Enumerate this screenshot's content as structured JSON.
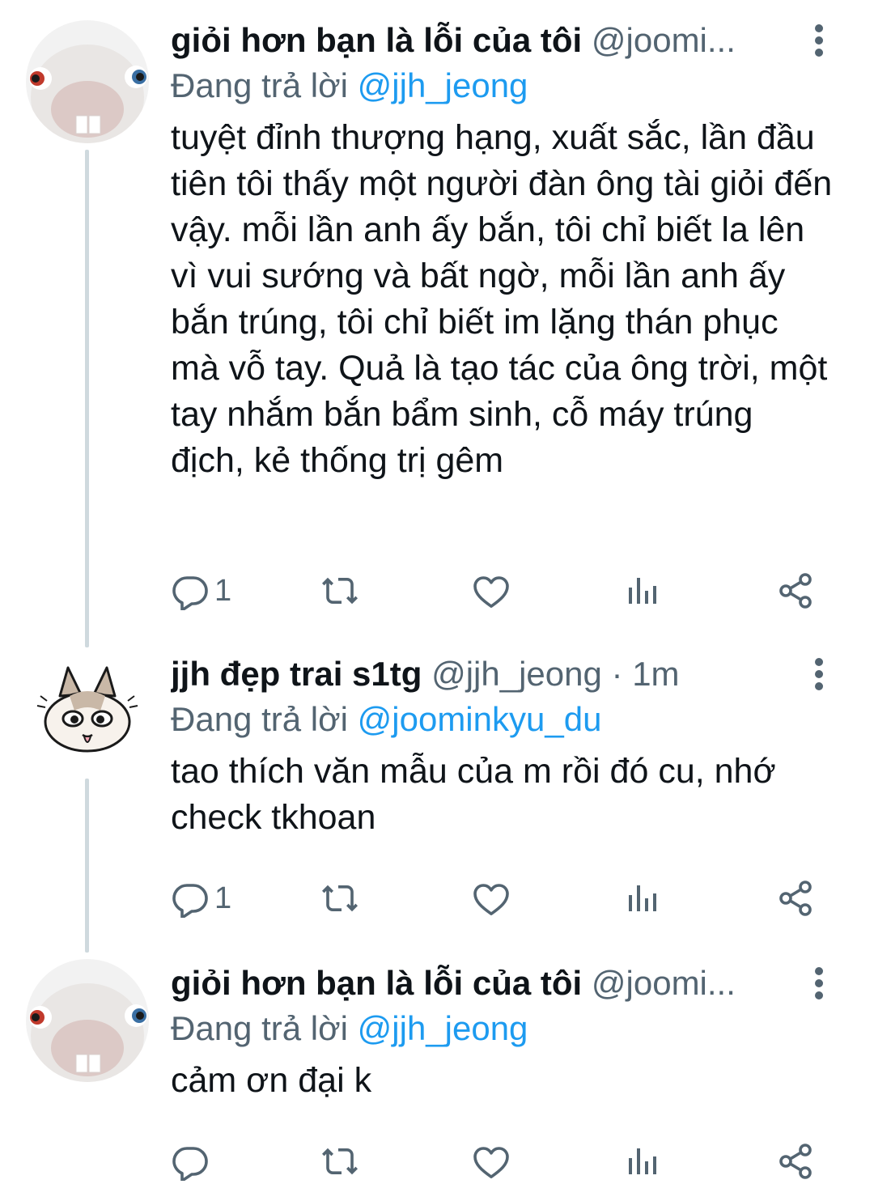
{
  "tweets": [
    {
      "display_name": "giỏi hơn bạn là lỗi của tôi",
      "handle": "@joomi...",
      "separator": "",
      "time": "",
      "reply_prefix": "Đang trả lời",
      "reply_mention": "@jjh_jeong",
      "text": "tuyệt đỉnh thượng hạng, xuất sắc, lần đầu tiên tôi thấy một người đàn ông tài giỏi đến vậy. mỗi lần anh ấy bắn, tôi chỉ biết la lên vì vui sướng và bất ngờ, mỗi lần anh ấy bắn trúng, tôi chỉ biết im lặng thán phục mà vỗ tay. Quả là tạo tác của ông trời, một tay nhắm bắn bẩm sinh, cỗ máy trúng địch, kẻ thống trị gêm",
      "reply_count": "1",
      "avatar": "rabbid-avatar"
    },
    {
      "display_name": "jjh đẹp trai s1tg",
      "handle": "@jjh_jeong",
      "separator": "·",
      "time": "1m",
      "reply_prefix": "Đang trả lời",
      "reply_mention": "@joominkyu_du",
      "text": "tao thích văn mẫu của m rồi đó cu, nhớ check tkhoan",
      "reply_count": "1",
      "avatar": "cat-avatar"
    },
    {
      "display_name": "giỏi hơn bạn là lỗi của tôi",
      "handle": "@joomi...",
      "separator": "",
      "time": "",
      "reply_prefix": "Đang trả lời",
      "reply_mention": "@jjh_jeong",
      "text": "cảm ơn đại k",
      "reply_count": "",
      "avatar": "rabbid-avatar"
    }
  ],
  "icons": {
    "reply": "reply-icon",
    "retweet": "retweet-icon",
    "like": "heart-icon",
    "views": "analytics-icon",
    "share": "share-icon",
    "more": "more-dots-icon"
  },
  "colors": {
    "text": "#0f1419",
    "secondary": "#536471",
    "link": "#1d9bf0",
    "thread_line": "#cfd9de"
  }
}
